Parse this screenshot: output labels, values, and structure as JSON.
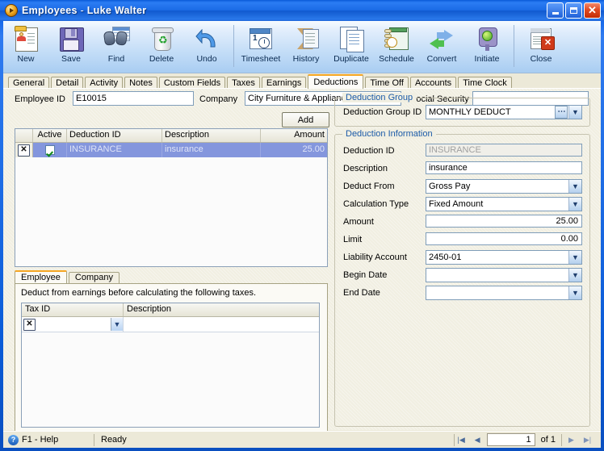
{
  "window": {
    "title_app": "Employees",
    "title_sep": " - ",
    "title_record": "Luke  Walter",
    "icon": "app-circle-arrow-icon",
    "minimize_label": "_",
    "maximize_label": "□",
    "close_label": "✕"
  },
  "toolbar": {
    "buttons": [
      {
        "label": "New",
        "icon": "new-employee-card-icon"
      },
      {
        "label": "Save",
        "icon": "floppy-disk-icon"
      },
      {
        "label": "Find",
        "icon": "binoculars-icon"
      },
      {
        "label": "Delete",
        "icon": "recycle-bin-icon"
      },
      {
        "label": "Undo",
        "icon": "undo-arrow-icon"
      },
      {
        "label": "Timesheet",
        "icon": "timesheet-clock-icon"
      },
      {
        "label": "History",
        "icon": "hourglass-history-icon"
      },
      {
        "label": "Duplicate",
        "icon": "duplicate-pages-icon"
      },
      {
        "label": "Schedule",
        "icon": "schedule-calendar-clock-icon"
      },
      {
        "label": "Convert",
        "icon": "convert-arrows-icon"
      },
      {
        "label": "Initiate",
        "icon": "traffic-light-icon"
      },
      {
        "label": "Close",
        "icon": "close-document-icon"
      }
    ]
  },
  "tabs": {
    "items": [
      {
        "label": "General"
      },
      {
        "label": "Detail"
      },
      {
        "label": "Activity"
      },
      {
        "label": "Notes"
      },
      {
        "label": "Custom Fields"
      },
      {
        "label": "Taxes"
      },
      {
        "label": "Earnings"
      },
      {
        "label": "Deductions"
      },
      {
        "label": "Time Off"
      },
      {
        "label": "Accounts"
      },
      {
        "label": "Time Clock"
      }
    ],
    "active": "Deductions"
  },
  "header_fields": {
    "employee_id_label": "Employee ID",
    "employee_id_value": "E10015",
    "company_label": "Company",
    "company_value": "City Furniture & Appliance, Inc.",
    "social_security_label": "Social Security",
    "social_security_value": ""
  },
  "deduction_grid": {
    "add_button": "Add",
    "columns": [
      "",
      "Active",
      "Deduction ID",
      "Description",
      "Amount"
    ],
    "rows": [
      {
        "delete": "✕",
        "active": true,
        "deduction_id": "INSURANCE",
        "description": "insurance",
        "amount": "25.00"
      }
    ]
  },
  "sub_tabs": {
    "items": [
      {
        "label": "Employee"
      },
      {
        "label": "Company"
      }
    ],
    "active": "Employee",
    "note": "Deduct from earnings before calculating the following taxes.",
    "tax_grid": {
      "columns": [
        "Tax ID",
        "Description"
      ],
      "rows": [
        {
          "delete": "✕",
          "tax_id": "",
          "description": ""
        }
      ]
    }
  },
  "deduction_group": {
    "legend": "Deduction Group",
    "id_label": "Deduction Group ID",
    "id_value": "MONTHLY DEDUCT",
    "lookup_glyph": "⋯",
    "dropdown_glyph": "⌄"
  },
  "deduction_information": {
    "legend": "Deduction Information",
    "fields": [
      {
        "label": "Deduction ID",
        "value": "INSURANCE",
        "type": "readonly"
      },
      {
        "label": "Description",
        "value": "insurance",
        "type": "text"
      },
      {
        "label": "Deduct From",
        "value": "Gross Pay",
        "type": "select"
      },
      {
        "label": "Calculation Type",
        "value": "Fixed Amount",
        "type": "select"
      },
      {
        "label": "Amount",
        "value": "25.00",
        "type": "number"
      },
      {
        "label": "Limit",
        "value": "0.00",
        "type": "number"
      },
      {
        "label": "Liability Account",
        "value": "2450-01",
        "type": "select"
      },
      {
        "label": "Begin Date",
        "value": "",
        "type": "select"
      },
      {
        "label": "End Date",
        "value": "",
        "type": "select"
      }
    ]
  },
  "status_bar": {
    "help_icon": "question-mark-icon",
    "help_label": "F1 - Help",
    "status_text": "Ready",
    "nav": {
      "first_glyph": "|◀",
      "prev_glyph": "◀",
      "page_value": "1",
      "of_label": "of  1",
      "next_glyph": "▶",
      "last_glyph": "▶|"
    }
  },
  "colors": {
    "title_blue": "#1b6be6",
    "accent_orange": "#f5a623",
    "selection_blue": "#8496dd",
    "legend_blue": "#1c5ba8",
    "close_red": "#d03a1a"
  }
}
